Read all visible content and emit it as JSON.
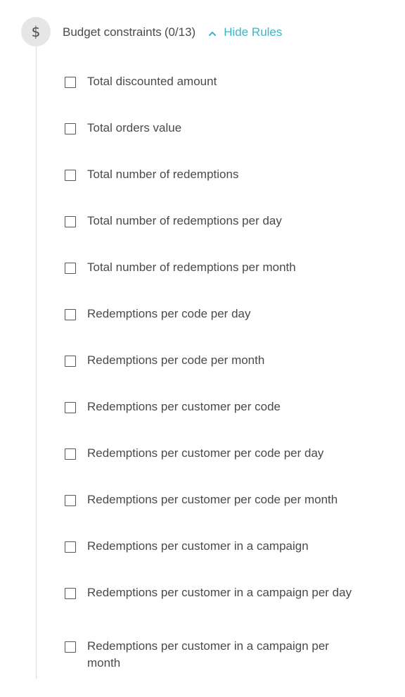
{
  "section": {
    "icon": "dollar-icon",
    "icon_glyph": "$",
    "title": "Budget constraints",
    "count": "(0/13)",
    "toggle_label": "Hide Rules",
    "toggle_icon": "chevron-up-icon",
    "accent_color": "#3cb6c6"
  },
  "rules": [
    {
      "label": "Total discounted amount",
      "checked": false
    },
    {
      "label": "Total orders value",
      "checked": false
    },
    {
      "label": "Total number of redemptions",
      "checked": false
    },
    {
      "label": "Total number of redemptions per day",
      "checked": false
    },
    {
      "label": "Total number of redemptions per month",
      "checked": false
    },
    {
      "label": "Redemptions per code per day",
      "checked": false
    },
    {
      "label": "Redemptions per code per month",
      "checked": false
    },
    {
      "label": "Redemptions per customer per code",
      "checked": false
    },
    {
      "label": "Redemptions per customer per code per day",
      "checked": false
    },
    {
      "label": "Redemptions per customer per code per month",
      "checked": false
    },
    {
      "label": "Redemptions per customer in a campaign",
      "checked": false
    },
    {
      "label": "Redemptions per customer in a campaign per day",
      "checked": false
    },
    {
      "label": "Redemptions per customer in a campaign per month",
      "checked": false
    }
  ]
}
